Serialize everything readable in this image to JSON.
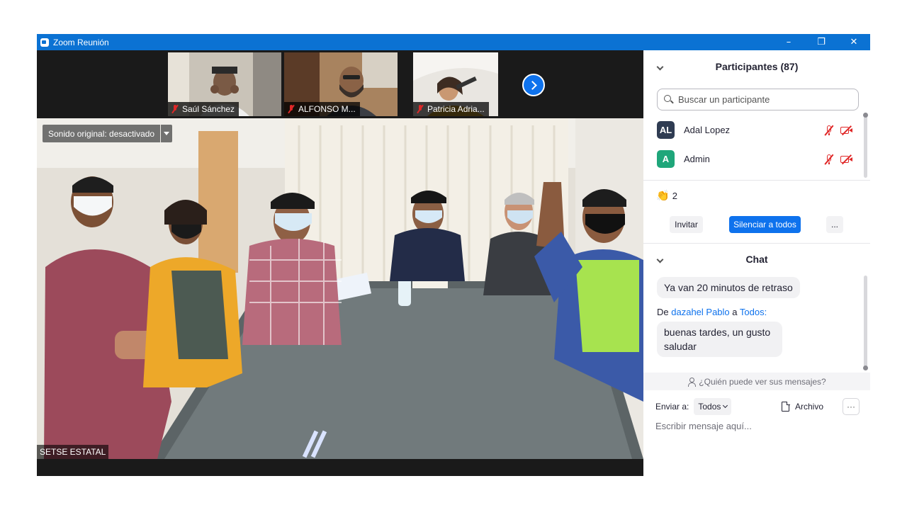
{
  "window": {
    "title": "Zoom Reunión",
    "controls": {
      "minimize": "–",
      "restore": "❐",
      "close": "✕"
    }
  },
  "thumbnails": [
    {
      "name": "Saúl Sánchez",
      "muted": true
    },
    {
      "name": "ALFONSO M...",
      "muted": true
    },
    {
      "name": "Patricia Adria...",
      "muted": true
    }
  ],
  "main_video": {
    "sound_badge": "Sonido original: desactivado",
    "speaker": "SETSE ESTATAL"
  },
  "participants": {
    "title": "Participantes (87)",
    "search_placeholder": "Buscar un participante",
    "list": [
      {
        "initials": "AL",
        "name": "Adal Lopez",
        "color": "#2f3c52"
      },
      {
        "initials": "A",
        "name": "Admin",
        "color": "#1fa67a"
      }
    ],
    "reaction_count": "2",
    "buttons": {
      "invite": "Invitar",
      "mute_all": "Silenciar a todos",
      "more": "..."
    }
  },
  "chat": {
    "title": "Chat",
    "messages": [
      {
        "text": "Ya van 20 minutos de retraso"
      },
      {
        "from_prefix": "De",
        "from": "dazahel Pablo",
        "to_prefix": "a",
        "to": "Todos:",
        "text": "buenas tardes, un gusto saludar"
      }
    ],
    "who_sees": "¿Quién puede ver sus mensajes?",
    "send_to_label": "Enviar a:",
    "send_to_value": "Todos",
    "file_label": "Archivo",
    "more": "···",
    "input_placeholder": "Escribir mensaje aquí..."
  },
  "colors": {
    "titlebar": "#0b72d3",
    "accent": "#0e72ed",
    "muted_icon": "#e02828"
  }
}
